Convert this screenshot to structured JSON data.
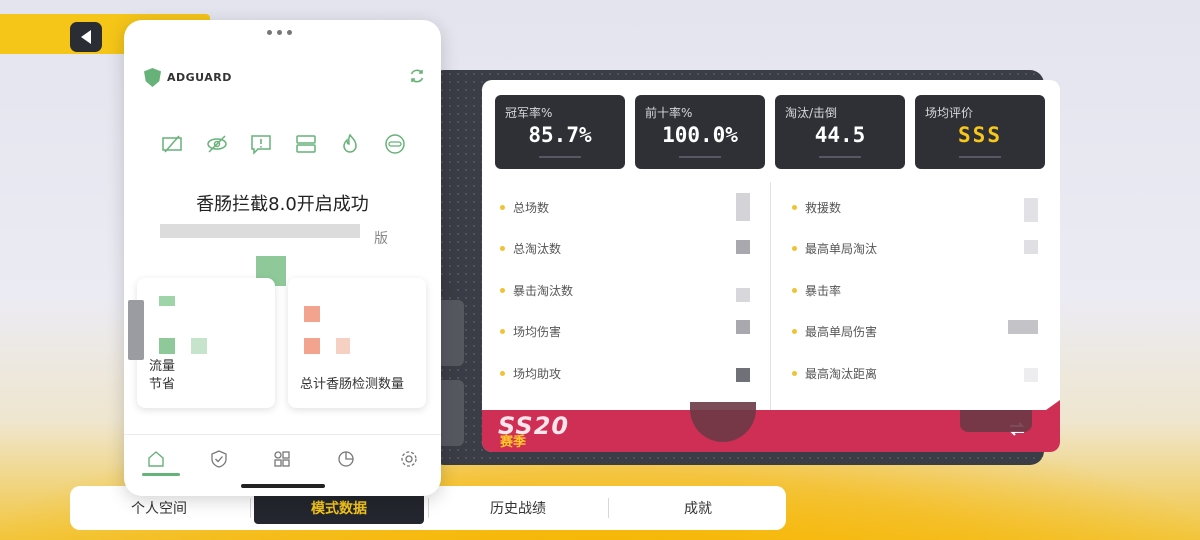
{
  "adguard": {
    "brand": "ADGUARD",
    "title": "香肠拦截8.0开启成功",
    "subtitle_tail": "版",
    "cards": [
      {
        "label_line1": "流量",
        "label_line2": "节省"
      },
      {
        "label_line1": "总计香肠检测数量"
      }
    ],
    "features": [
      "no-ads-icon",
      "eye-off-icon",
      "message-alert-icon",
      "server-icon",
      "fire-icon",
      "face-icon"
    ],
    "nav": [
      "home-icon",
      "shield-check-icon",
      "apps-icon",
      "stats-icon",
      "settings-icon"
    ]
  },
  "stats": {
    "boxes": [
      {
        "label": "冠军率%",
        "value": "85.7%"
      },
      {
        "label": "前十率%",
        "value": "100.0%"
      },
      {
        "label": "淘汰/击倒",
        "value": "44.5"
      },
      {
        "label": "场均评价",
        "value": "SSS"
      }
    ],
    "left_rows": [
      "总场数",
      "总淘汰数",
      "暴击淘汰数",
      "场均伤害",
      "场均助攻"
    ],
    "right_rows": [
      "救援数",
      "最高单局淘汰",
      "暴击率",
      "最高单局伤害",
      "最高淘汰距离"
    ],
    "season_code": "SS20",
    "season_label": "赛季"
  },
  "tabs": [
    "个人空间",
    "模式数据",
    "历史战绩",
    "成就"
  ],
  "active_tab": "模式数据",
  "colors": {
    "accent_yellow": "#f5c518",
    "season_red": "#cf2f55",
    "adguard_green": "#67b279",
    "panel_dark": "#2e3036"
  }
}
